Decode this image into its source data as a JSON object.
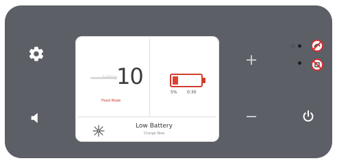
{
  "display": {
    "speed_value": "10",
    "speed_label": "Setting",
    "speed_caption": "Fixed Mode",
    "battery_percent_text": "5%",
    "battery_time_text": "0:30",
    "battery_level": 0.2,
    "alert_title": "Low Battery",
    "alert_subtitle": "Charge Now"
  },
  "icons": {
    "settings": "gear-icon",
    "sound": "speaker-icon",
    "increase": "plus-icon",
    "decrease": "minus-icon",
    "power": "power-icon",
    "fan": "fan-icon",
    "status_1": "no-flow-icon",
    "status_2": "no-power-icon"
  },
  "colors": {
    "panel": "#5d5f67",
    "screen": "#ffffff",
    "battery_red": "#e04232",
    "status_red": "#d32f2f"
  }
}
